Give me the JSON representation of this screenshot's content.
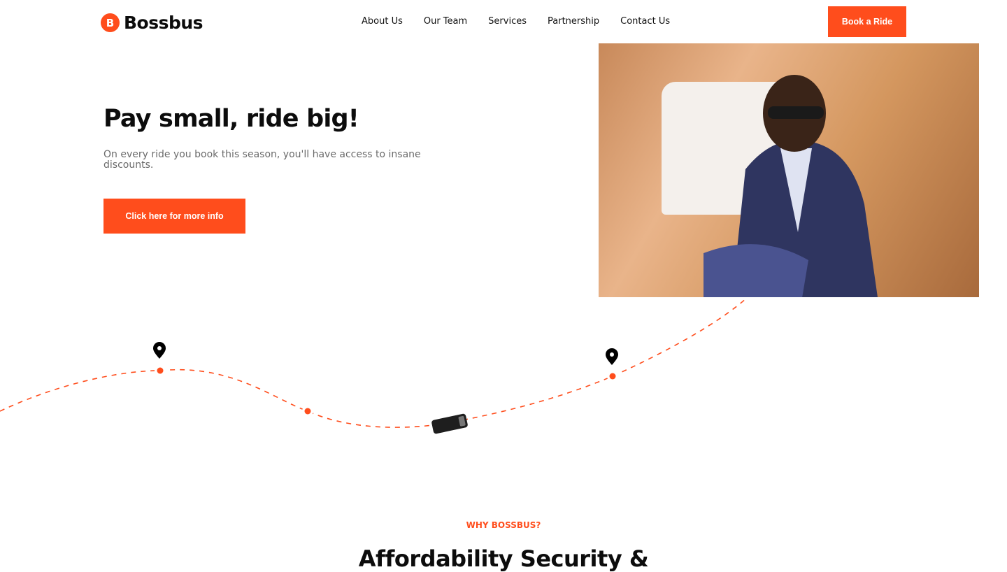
{
  "brand": {
    "name": "Bossbus",
    "accent": "#ff4d1c"
  },
  "nav": {
    "items": [
      "About Us",
      "Our Team",
      "Services",
      "Partnership",
      "Contact Us"
    ],
    "book_label": "Book a Ride"
  },
  "hero": {
    "title": "Pay small, ride big!",
    "subtitle": "On every ride you book this season, you'll have access to insane discounts.",
    "cta_label": "Click here for more info"
  },
  "why": {
    "eyebrow": "WHY BOSSBUS?",
    "heading": "Affordability Security &"
  }
}
